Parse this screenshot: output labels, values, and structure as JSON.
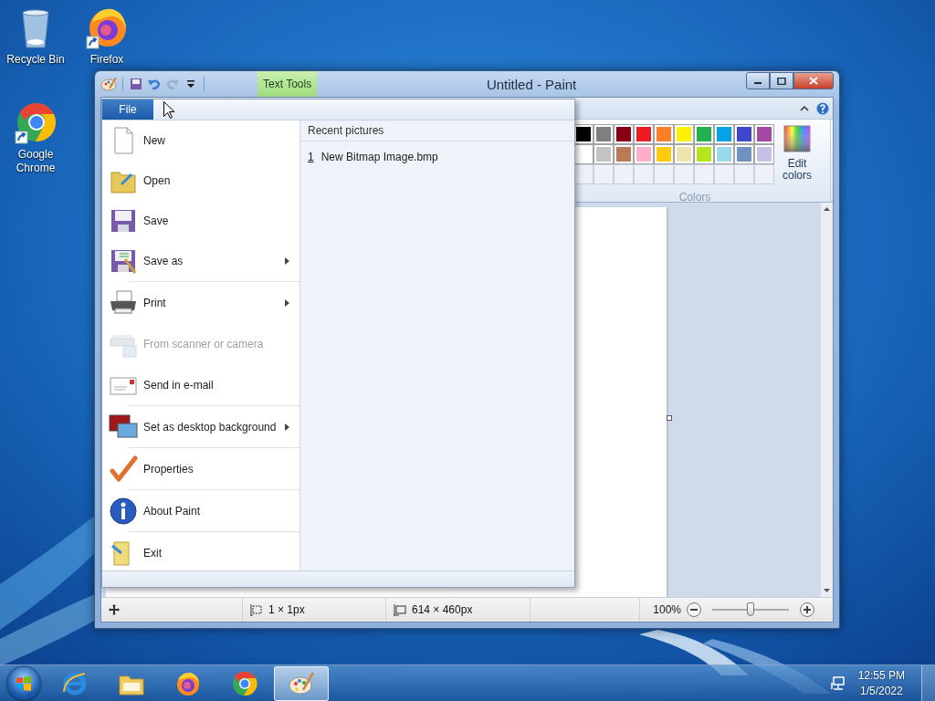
{
  "desktop_icons": [
    {
      "label": "Recycle Bin",
      "kind": "recycle",
      "shortcut": false
    },
    {
      "label": "Firefox",
      "kind": "firefox",
      "shortcut": true
    },
    {
      "label": "Google Chrome",
      "kind": "chrome",
      "shortcut": true
    }
  ],
  "window": {
    "title": "Untitled - Paint",
    "contextual_tab": "Text Tools",
    "quick_access": [
      {
        "kind": "save",
        "disabled": false
      },
      {
        "kind": "undo",
        "disabled": false
      },
      {
        "kind": "redo",
        "disabled": true
      },
      {
        "kind": "customize",
        "disabled": false
      }
    ]
  },
  "file_tab": {
    "label": "File"
  },
  "file_menu": {
    "groups": [
      {
        "items": [
          {
            "label": "New",
            "kind": "new",
            "submenu": false,
            "disabled": false
          },
          {
            "label": "Open",
            "kind": "open",
            "submenu": false,
            "disabled": false
          },
          {
            "label": "Save",
            "kind": "save",
            "submenu": false,
            "disabled": false
          },
          {
            "label": "Save as",
            "kind": "saveas",
            "submenu": true,
            "disabled": false
          }
        ]
      },
      {
        "items": [
          {
            "label": "Print",
            "kind": "print",
            "submenu": true,
            "disabled": false
          },
          {
            "label": "From scanner or camera",
            "kind": "scanner",
            "submenu": false,
            "disabled": true
          },
          {
            "label": "Send in e-mail",
            "kind": "email",
            "submenu": false,
            "disabled": false
          }
        ]
      },
      {
        "items": [
          {
            "label": "Set as desktop background",
            "kind": "desktop",
            "submenu": true,
            "disabled": false
          }
        ]
      },
      {
        "items": [
          {
            "label": "Properties",
            "kind": "properties",
            "submenu": false,
            "disabled": false
          }
        ]
      },
      {
        "items": [
          {
            "label": "About Paint",
            "kind": "about",
            "submenu": false,
            "disabled": false
          }
        ]
      },
      {
        "items": [
          {
            "label": "Exit",
            "kind": "exit",
            "submenu": false,
            "disabled": false
          }
        ]
      }
    ]
  },
  "recent": {
    "heading": "Recent pictures",
    "items": [
      {
        "number": "1",
        "name": "New Bitmap Image.bmp"
      }
    ]
  },
  "colors": {
    "label": "Colors",
    "edit_label": "Edit colors",
    "swatches": [
      {
        "kind": "filled",
        "color": "#000000"
      },
      {
        "kind": "filled",
        "color": "#7f7f7f"
      },
      {
        "kind": "filled",
        "color": "#880015"
      },
      {
        "kind": "filled",
        "color": "#ed1c24"
      },
      {
        "kind": "filled",
        "color": "#ff7f27"
      },
      {
        "kind": "filled",
        "color": "#fff200"
      },
      {
        "kind": "filled",
        "color": "#22b14c"
      },
      {
        "kind": "filled",
        "color": "#00a2e8"
      },
      {
        "kind": "filled",
        "color": "#3f48cc"
      },
      {
        "kind": "filled",
        "color": "#a349a4"
      },
      {
        "kind": "filled",
        "color": "#ffffff"
      },
      {
        "kind": "filled",
        "color": "#c3c3c3"
      },
      {
        "kind": "filled",
        "color": "#b97a57"
      },
      {
        "kind": "filled",
        "color": "#ffaec9"
      },
      {
        "kind": "filled",
        "color": "#ffc90e"
      },
      {
        "kind": "filled",
        "color": "#efe4b0"
      },
      {
        "kind": "filled",
        "color": "#b5e61d"
      },
      {
        "kind": "filled",
        "color": "#99d9ea"
      },
      {
        "kind": "filled",
        "color": "#7092be"
      },
      {
        "kind": "filled",
        "color": "#c8bfe7"
      },
      {
        "kind": "empty"
      },
      {
        "kind": "empty"
      },
      {
        "kind": "empty"
      },
      {
        "kind": "empty"
      },
      {
        "kind": "empty"
      },
      {
        "kind": "empty"
      },
      {
        "kind": "empty"
      },
      {
        "kind": "empty"
      },
      {
        "kind": "empty"
      },
      {
        "kind": "empty"
      }
    ]
  },
  "status_bar": {
    "selection_size": "1 × 1px",
    "canvas_size": "614 × 460px",
    "zoom": "100%",
    "zoom_slider": {
      "level": 0.5
    }
  },
  "taskbar": {
    "items": [
      {
        "kind": "ie",
        "selected": false
      },
      {
        "kind": "explorer",
        "selected": false
      },
      {
        "kind": "firefox",
        "selected": false
      },
      {
        "kind": "chrome",
        "selected": false
      },
      {
        "kind": "paint",
        "selected": true
      }
    ],
    "clock": {
      "time": "12:55 PM",
      "date": "1/5/2022"
    }
  }
}
